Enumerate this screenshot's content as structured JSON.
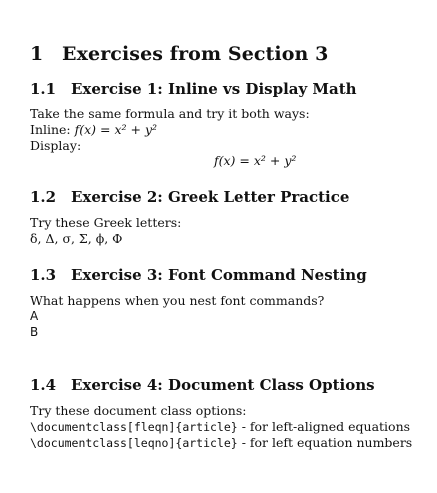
{
  "section": {
    "number": "1",
    "title": "Exercises from Section 3"
  },
  "ex1": {
    "number": "1.1",
    "title": "Exercise 1: Inline vs Display Math",
    "intro": "Take the same formula and try it both ways:",
    "inline_label": "Inline: ",
    "inline_formula": "f(x) = x² + y²",
    "display_label": "Display:",
    "display_formula": "f(x) = x² + y²"
  },
  "ex2": {
    "number": "1.2",
    "title": "Exercise 2: Greek Letter Practice",
    "intro": "Try these Greek letters:",
    "letters": "δ, Δ, σ, Σ, ϕ, Φ"
  },
  "ex3": {
    "number": "1.3",
    "title": "Exercise 3: Font Command Nesting",
    "intro": "What happens when you nest font commands?",
    "line_a": "A",
    "line_b": "B"
  },
  "ex4": {
    "number": "1.4",
    "title": "Exercise 4: Document Class Options",
    "intro": "Try these document class options:",
    "opt1_code": "\\documentclass[fleqn]{article}",
    "opt1_desc": " - for left-aligned equations",
    "opt2_code": "\\documentclass[leqno]{article}",
    "opt2_desc": " - for left equation numbers"
  }
}
